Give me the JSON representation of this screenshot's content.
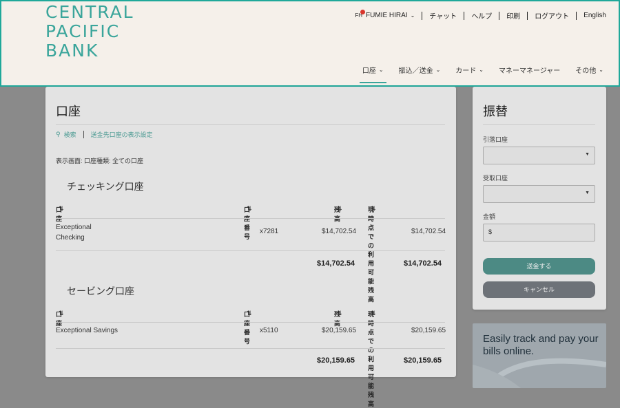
{
  "header": {
    "logo_line1": "CENTRAL",
    "logo_line2": "PACIFIC",
    "logo_line3": "BANK",
    "avatar_initials": "FH",
    "user_name": "FUMIE HIRAI",
    "util_links": [
      "チャット",
      "ヘルプ",
      "印刷",
      "ログアウト",
      "English"
    ],
    "nav": [
      "口座",
      "振込／送金",
      "カード",
      "マネーマネージャー",
      "その他"
    ]
  },
  "accounts": {
    "title": "口座",
    "search_link": "検索",
    "display_settings_link": "送金先口座の表示設定",
    "filter_text": "表示画面: 口座種類: 全ての口座",
    "columns": {
      "account": "口座",
      "number": "口座番号",
      "balance": "残高",
      "available": "現時点での利用可能残高"
    },
    "checking": {
      "title": "チェッキング口座",
      "row": {
        "name_line1": "Exceptional",
        "name_line2": "Checking",
        "number": "x7281",
        "balance": "$14,702.54",
        "available": "$14,702.54"
      },
      "total_balance": "$14,702.54",
      "total_available": "$14,702.54"
    },
    "savings": {
      "title": "セービング口座",
      "row": {
        "name": "Exceptional Savings",
        "number": "x5110",
        "balance": "$20,159.65",
        "available": "$20,159.65"
      },
      "total_balance": "$20,159.65",
      "total_available": "$20,159.65"
    }
  },
  "transfer": {
    "title": "振替",
    "from_label": "引落口座",
    "to_label": "受取口座",
    "amount_label": "金額",
    "amount_prefix": "$",
    "send_button": "送金する",
    "cancel_button": "キャンセル"
  },
  "promo": {
    "text": "Easily track and pay your bills online."
  }
}
